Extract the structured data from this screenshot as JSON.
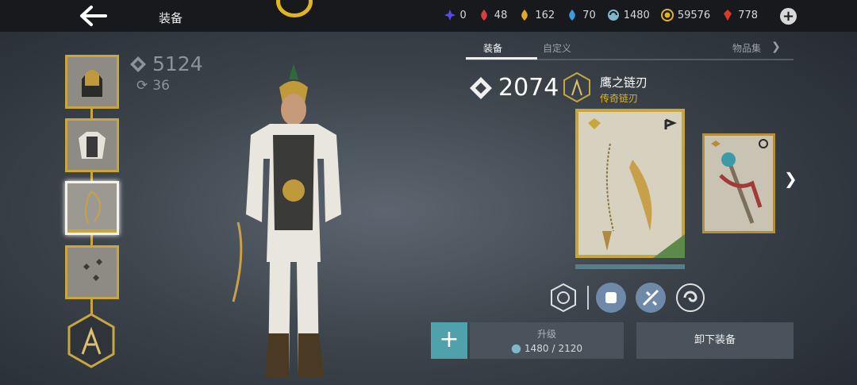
{
  "header": {
    "back_icon": "back-arrow-icon",
    "title": "装备",
    "emblem_icon": "clan-emblem-icon"
  },
  "currencies": [
    {
      "icon": "star-shard-icon",
      "color": "#4a4ae0",
      "value": "0"
    },
    {
      "icon": "red-flame-icon",
      "color": "#d8413a",
      "value": "48"
    },
    {
      "icon": "gold-flame-icon",
      "color": "#e0a830",
      "value": "162"
    },
    {
      "icon": "blue-flame-icon",
      "color": "#3d9be0",
      "value": "70"
    },
    {
      "icon": "swirl-icon",
      "color": "#7fb7c9",
      "value": "1480"
    },
    {
      "icon": "coin-icon",
      "color": "#e0b521",
      "value": "59576"
    },
    {
      "icon": "ruby-icon",
      "color": "#d83a2a",
      "value": "778"
    }
  ],
  "character": {
    "power": "5124",
    "regen": "36"
  },
  "tabs": [
    {
      "label": "装备",
      "active": true
    },
    {
      "label": "自定义",
      "active": false
    },
    {
      "label": "物品集",
      "active": false
    }
  ],
  "weapon": {
    "power": "2074",
    "name": "鹰之链刃",
    "rarity": "传奇链刃",
    "type_icon": "chain-blade-type-icon",
    "equipped": true
  },
  "skills": [
    {
      "icon": "ability-skill-icon"
    },
    {
      "icon": "fist-strike-icon"
    },
    {
      "icon": "shattered-strike-icon"
    },
    {
      "icon": "spiral-icon"
    }
  ],
  "actions": {
    "upgrade_label": "升级",
    "upgrade_cost_current": "1480",
    "upgrade_cost_sep": "/",
    "upgrade_cost_required": "2120",
    "unequip_label": "卸下装备"
  }
}
